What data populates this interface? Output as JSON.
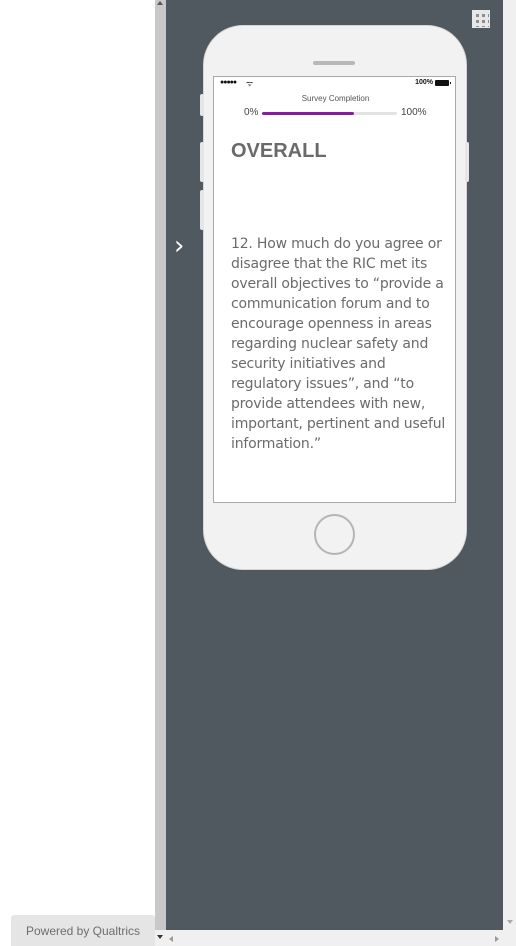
{
  "footer": {
    "powered_by": "Powered by Qualtrics"
  },
  "phone": {
    "status": {
      "signal": "●●●●●",
      "wifi": "ᯤ",
      "battery_pct": "100%"
    },
    "progress": {
      "label": "Survey Completion",
      "start": "0%",
      "end": "100%",
      "value": 0.68,
      "color": "#8a1c9e"
    }
  },
  "question": {
    "section_title": "OVERALL",
    "text": "12. How much do you agree or disagree that the RIC met its overall objectives to “provide a communication forum and to encourage openness in areas regarding nuclear safety and security initiatives and regulatory issues”, and “to provide attendees with new, important, pertinent and useful information.”"
  },
  "icons": {
    "next": "chevron-right-icon",
    "qr": "qr-code-icon"
  }
}
